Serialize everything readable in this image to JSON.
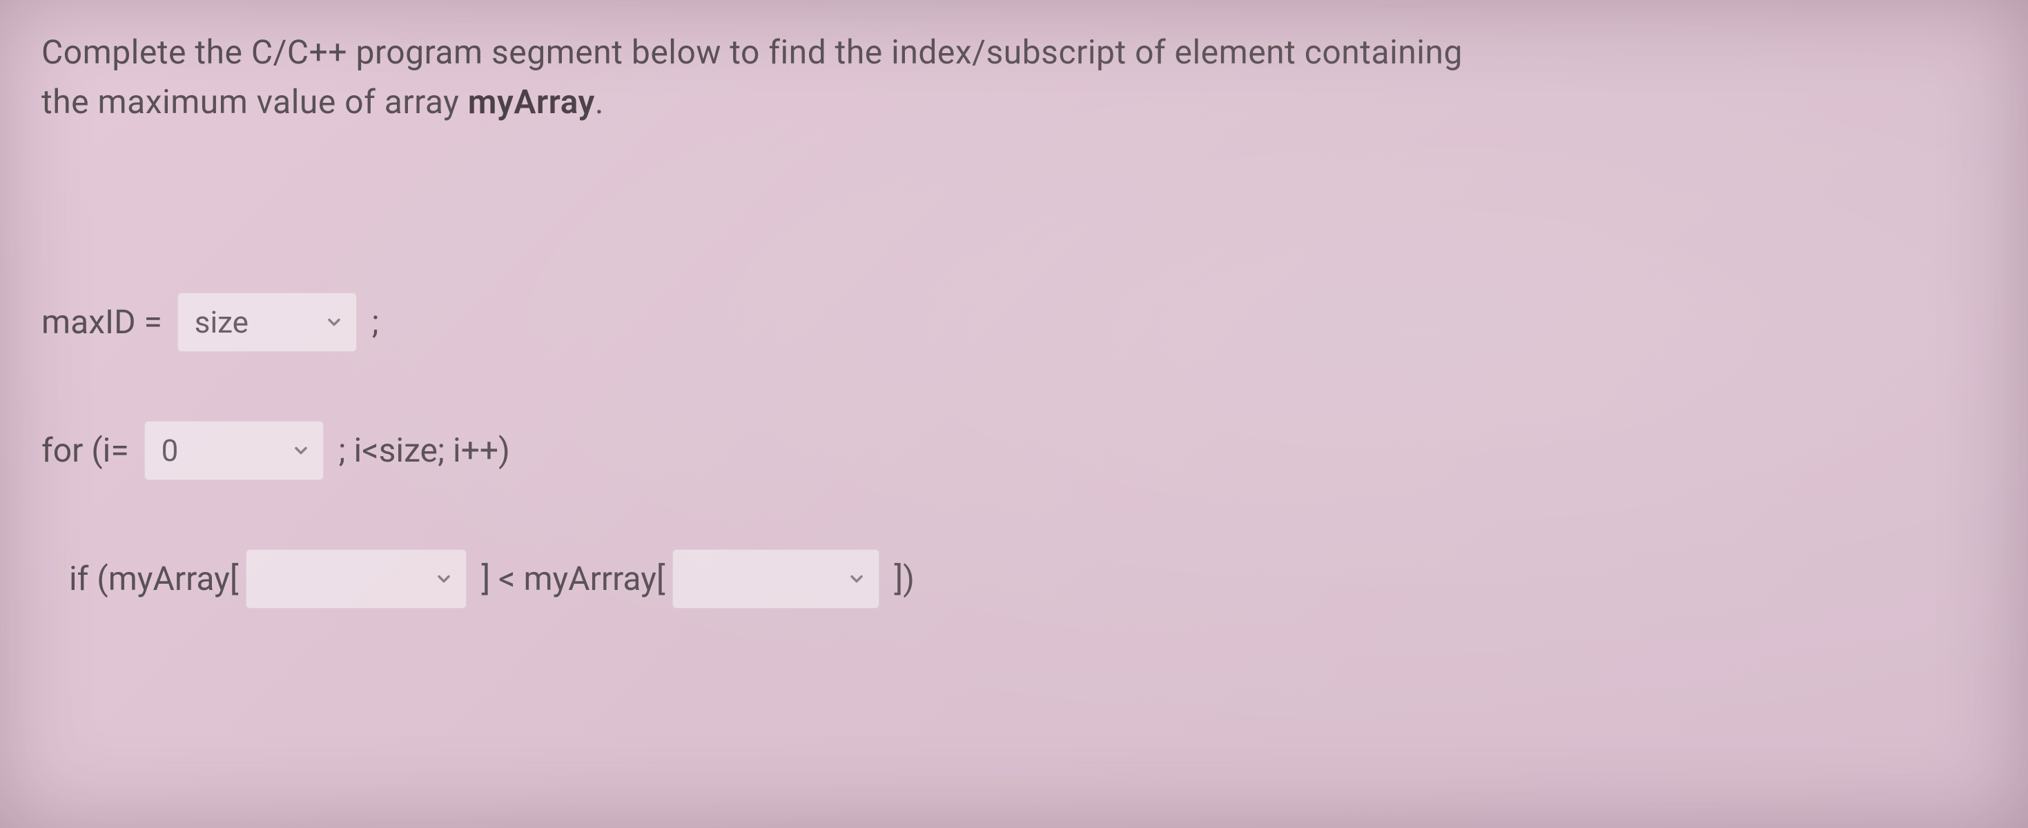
{
  "question": {
    "intro_part1": "Complete the C/C++ program segment below to find the index/subscript of element containing",
    "intro_part2": "the maximum value of array ",
    "intro_bold": "myArray",
    "intro_period": "."
  },
  "code": {
    "line1": {
      "prefix": "maxID = ",
      "dropdown_value": "size",
      "suffix": " ;"
    },
    "line2": {
      "prefix": "for (i= ",
      "dropdown_value": "0",
      "suffix": " ; i<size; i++)"
    },
    "line3": {
      "prefix": "if (myArray[",
      "dropdown1_value": "",
      "mid": " ] < myArrray[",
      "dropdown2_value": "",
      "suffix": " ])"
    }
  }
}
